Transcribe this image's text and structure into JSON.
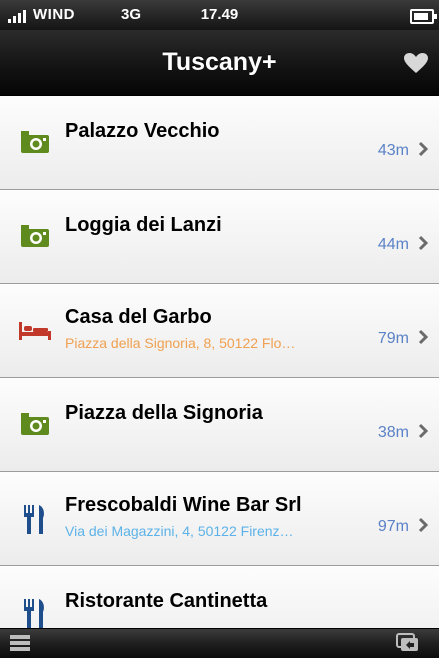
{
  "status": {
    "carrier": "WIND",
    "network": "3G",
    "time": "17.49",
    "battery_level": 0.85
  },
  "nav": {
    "title": "Tuscany+",
    "favorites_icon": "heart-icon"
  },
  "places": [
    {
      "title": "Palazzo Vecchio",
      "subtitle": "",
      "distance": "43m",
      "icon": "camera-icon",
      "subtitle_color": ""
    },
    {
      "title": "Loggia dei Lanzi",
      "subtitle": "",
      "distance": "44m",
      "icon": "camera-icon",
      "subtitle_color": ""
    },
    {
      "title": "Casa del Garbo",
      "subtitle": "Piazza della Signoria, 8, 50122 Flo…",
      "distance": "79m",
      "icon": "bed-icon",
      "subtitle_color": "#f0a050"
    },
    {
      "title": "Piazza della Signoria",
      "subtitle": "",
      "distance": "38m",
      "icon": "camera-icon",
      "subtitle_color": ""
    },
    {
      "title": "Frescobaldi Wine Bar Srl",
      "subtitle": "Via dei Magazzini, 4, 50122 Firenz…",
      "distance": "97m",
      "icon": "restaurant-icon",
      "subtitle_color": "#5cb2e8"
    },
    {
      "title": "Ristorante Cantinetta",
      "subtitle": "",
      "distance": "",
      "icon": "restaurant-icon",
      "subtitle_color": ""
    }
  ],
  "toolbar": {
    "menu_icon": "menu-icon",
    "window_icon": "window-icon"
  },
  "colors": {
    "camera": "#5e8a1e",
    "bed": "#c0392b",
    "restaurant": "#1f4e8c",
    "distance": "#5a82c7"
  }
}
